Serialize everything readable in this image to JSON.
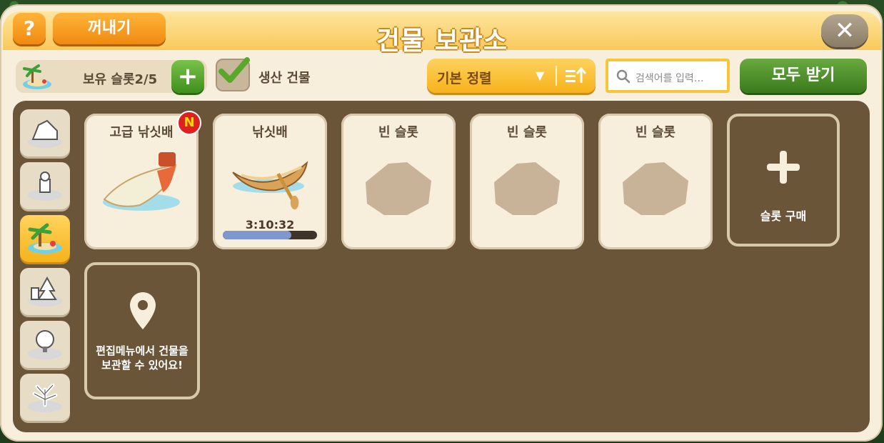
{
  "window": {
    "title": "건물 보관소",
    "help_label": "?",
    "takeout_label": "꺼내기",
    "close_icon": "close-icon"
  },
  "toolbar": {
    "slot_label": "보유 슬롯2/5",
    "add_slot_label": "+",
    "production_label": "생산 건물",
    "production_checked": true,
    "sort_label": "기본 정렬",
    "search_placeholder": "검색어를 입력…",
    "get_all_label": "모두 받기"
  },
  "categories": [
    {
      "icon": "house-category-icon",
      "active": false
    },
    {
      "icon": "decoration-category-icon",
      "active": false
    },
    {
      "icon": "island-category-icon",
      "active": true
    },
    {
      "icon": "tree-category-icon",
      "active": false
    },
    {
      "icon": "nature-category-icon",
      "active": false
    },
    {
      "icon": "coral-category-icon",
      "active": false
    }
  ],
  "slots": [
    {
      "title": "고급 낚싯배",
      "type": "item",
      "new_badge": "N",
      "icon": "speedboat-icon"
    },
    {
      "title": "낚싯배",
      "type": "item",
      "timer": "3:10:32",
      "progress": 0.73,
      "icon": "rowboat-icon"
    },
    {
      "title": "빈 슬롯",
      "type": "empty",
      "icon": "empty-slot-icon"
    },
    {
      "title": "빈 슬롯",
      "type": "empty",
      "icon": "empty-slot-icon"
    },
    {
      "title": "빈 슬롯",
      "type": "empty",
      "icon": "empty-slot-icon"
    }
  ],
  "buy_slot": {
    "label": "슬롯 구매"
  },
  "info_card": {
    "text": "편집메뉴에서 건물을 보관할 수 있어요!"
  },
  "colors": {
    "accent": "#f6b21a",
    "board": "#6b5539",
    "green": "#3f8f1d"
  }
}
